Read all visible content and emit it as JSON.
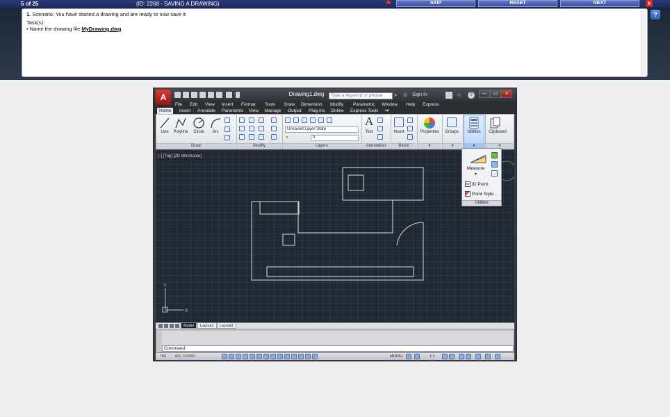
{
  "topbar": {
    "counter": "5 of 25",
    "task_id": "(ID: 2268 - SAVING A DRAWING)",
    "skip": "SKIP",
    "reset": "RESET",
    "next": "NEXT",
    "close": "x"
  },
  "task": {
    "scenario_num": "1.",
    "scenario": "Scenario: You have started a drawing and are ready to now save it.",
    "tasks_label": "Task(s):",
    "task_prefix": "• Name the drawing file",
    "task_file": "MyDrawing.dwg"
  },
  "help": "?",
  "acad": {
    "app_letter": "A",
    "doc_title": "Drawing1.dwg",
    "search_placeholder": "Type a keyword or phrase",
    "sign_in": "Sign In",
    "menu": [
      "File",
      "Edit",
      "View",
      "Insert",
      "Format",
      "Tools",
      "Draw",
      "Dimension",
      "Modify",
      "Parametric",
      "Window",
      "Help",
      "Express"
    ],
    "tabs": [
      "Home",
      "Insert",
      "Annotate",
      "Parametric",
      "View",
      "Manage",
      "Output",
      "Plug-ins",
      "Online",
      "Express Tools"
    ],
    "ribbon": {
      "draw_tools": [
        "Line",
        "Polyline",
        "Circle",
        "Arc"
      ],
      "panel_draw": "Draw",
      "panel_modify": "Modify",
      "panel_layers": "Layers",
      "layer_state": "Unsaved Layer State",
      "layer_name": "0",
      "text": "Text",
      "panel_annotation": "Annotation",
      "insert": "Insert",
      "panel_block": "Block",
      "properties": "Properties",
      "groups": "Groups",
      "utilities": "Utilities",
      "clipboard": "Clipboard"
    },
    "viewport_label": "[-] [Top] [2D Wireframe]",
    "utilities_popup": {
      "measure": "Measure",
      "id_point": "ID Point",
      "point_style": "Point Style...",
      "title": "Utilities"
    },
    "ucs": {
      "x": "X",
      "y": "Y"
    },
    "layout_tabs": [
      "Model",
      "Layout1",
      "Layout2"
    ],
    "command_prompt": "Command:",
    "status": {
      "x": "750",
      "y": "431",
      "z": "0.0000",
      "model": "MODEL",
      "scale": "1:1"
    }
  }
}
